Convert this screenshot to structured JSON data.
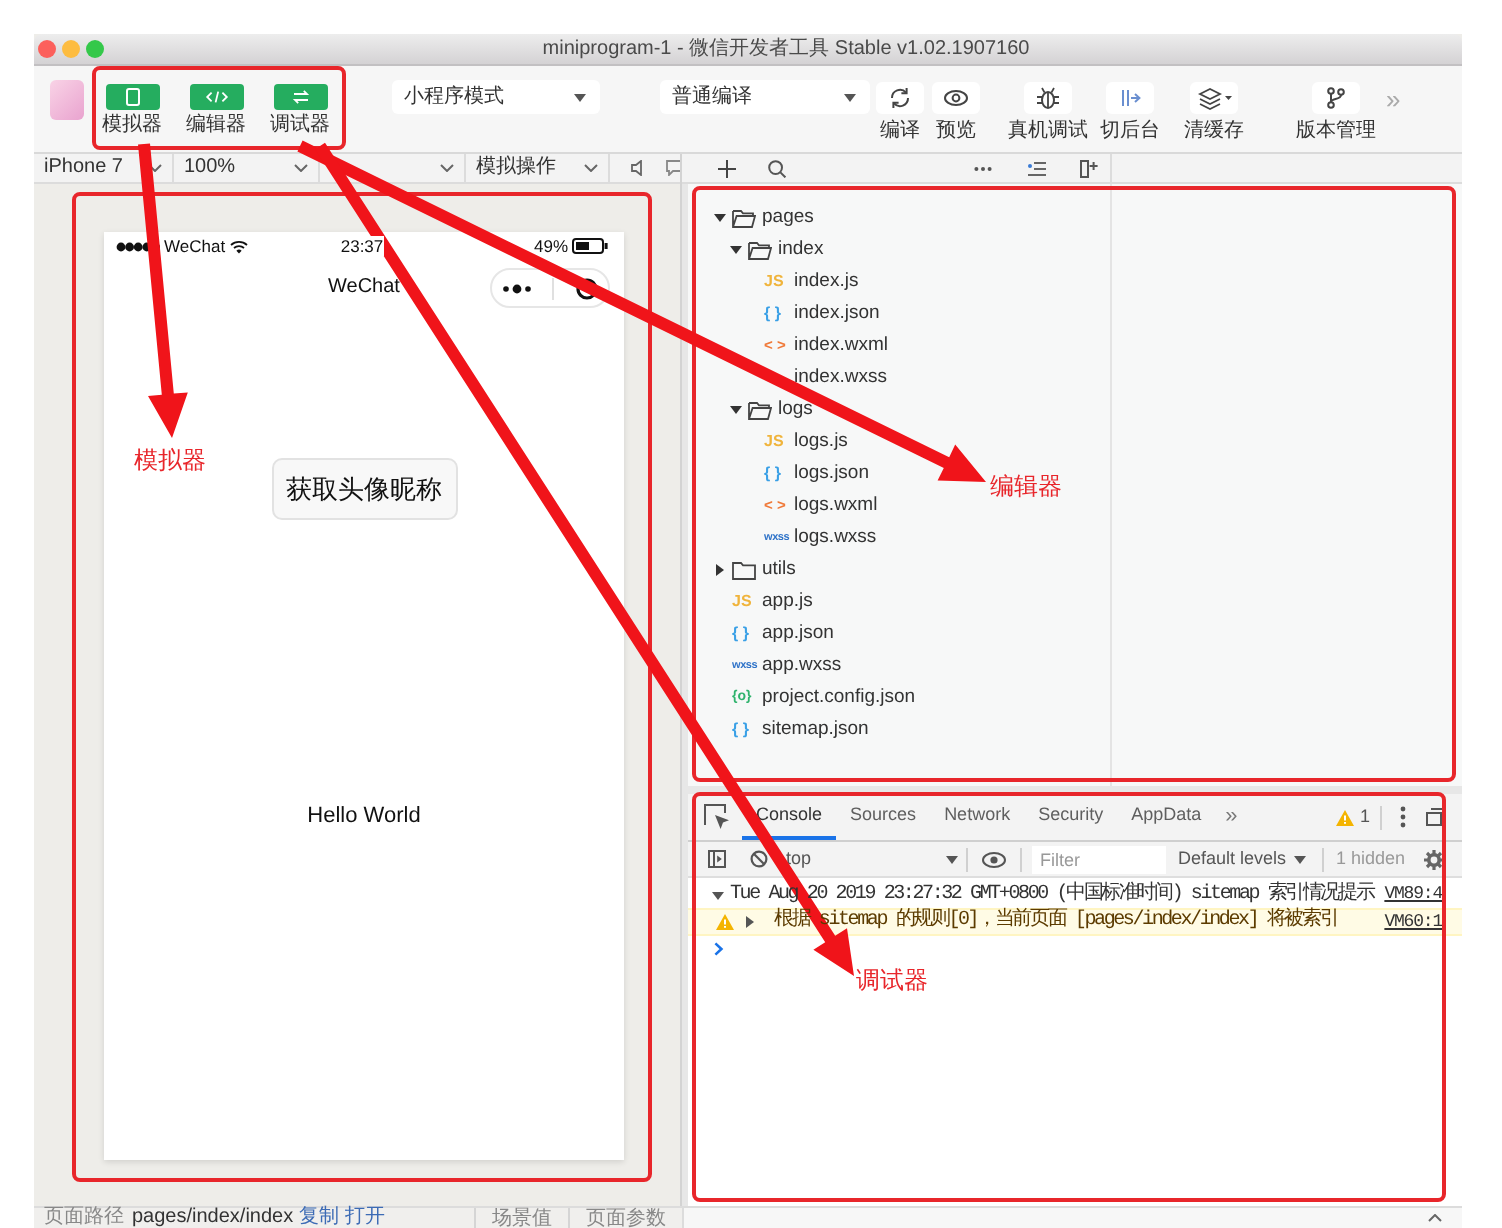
{
  "window": {
    "title": "miniprogram-1 - 微信开发者工具 Stable v1.02.1907160"
  },
  "toolbar": {
    "view_buttons": [
      {
        "kind": "simulator",
        "label": "模拟器",
        "on": true
      },
      {
        "kind": "editor",
        "label": "编辑器",
        "on": true
      },
      {
        "kind": "debugger",
        "label": "调试器",
        "on": true
      }
    ],
    "mode_select": "小程序模式",
    "compile_select": "普通编译",
    "actions": [
      {
        "kind": "compile",
        "label": "编译"
      },
      {
        "kind": "preview",
        "label": "预览"
      },
      {
        "kind": "remote_debug",
        "label": "真机调试"
      },
      {
        "kind": "background",
        "label": "切后台"
      },
      {
        "kind": "clear_cache",
        "label": "清缓存"
      },
      {
        "kind": "version",
        "label": "版本管理"
      }
    ],
    "more": "»"
  },
  "simulator_bar": {
    "device": "iPhone 7",
    "zoom": "100%",
    "operations": "模拟操作"
  },
  "phone": {
    "carrier": "WeChat",
    "time": "23:37",
    "battery": "49%",
    "nav_title": "WeChat",
    "button": "获取头像昵称",
    "content": "Hello World"
  },
  "file_tree": [
    {
      "name": "pages",
      "kind": "folder",
      "expanded": true,
      "children": [
        {
          "name": "index",
          "kind": "folder",
          "expanded": true,
          "children": [
            {
              "name": "index.js",
              "kind": "js",
              "icon": "JS"
            },
            {
              "name": "index.json",
              "kind": "json",
              "icon": "{ }"
            },
            {
              "name": "index.wxml",
              "kind": "wxml",
              "icon": "< >"
            },
            {
              "name": "index.wxss",
              "kind": "wxss"
            }
          ]
        },
        {
          "name": "logs",
          "kind": "folder",
          "expanded": true,
          "children": [
            {
              "name": "logs.js",
              "kind": "js",
              "icon": "JS"
            },
            {
              "name": "logs.json",
              "kind": "json",
              "icon": "{ }"
            },
            {
              "name": "logs.wxml",
              "kind": "wxml",
              "icon": "< >"
            },
            {
              "name": "logs.wxss",
              "kind": "wxss",
              "icon": "wxss"
            }
          ]
        }
      ]
    },
    {
      "name": "utils",
      "kind": "folder",
      "expanded": false
    },
    {
      "name": "app.js",
      "kind": "js",
      "icon": "JS"
    },
    {
      "name": "app.json",
      "kind": "json",
      "icon": "{ }"
    },
    {
      "name": "app.wxss",
      "kind": "wxss",
      "icon": "wxss"
    },
    {
      "name": "project.config.json",
      "kind": "config",
      "icon": "{o}"
    },
    {
      "name": "sitemap.json",
      "kind": "json",
      "icon": "{ }"
    }
  ],
  "debugger": {
    "tabs": [
      {
        "label": "Console",
        "selected": true
      },
      {
        "label": "Sources",
        "selected": false
      },
      {
        "label": "Network",
        "selected": false
      },
      {
        "label": "Security",
        "selected": false
      },
      {
        "label": "AppData",
        "selected": false
      }
    ],
    "more": "»",
    "warning_count": "1",
    "context": "top",
    "filter": {
      "placeholder": "Filter"
    },
    "levels": "Default levels",
    "hidden": "1 hidden",
    "messages": [
      {
        "kind": "info",
        "expanded": true,
        "text": "Tue Aug 20 2019 23:27:32 GMT+0800 (中国标准时间) sitemap 索引情况提示",
        "source": "VM89:4"
      },
      {
        "kind": "warning",
        "expanded": false,
        "text": "根据 sitemap 的规则[0]，当前页面 [pages/index/index] 将被索引",
        "source": "VM60:1"
      }
    ]
  },
  "status_bar": {
    "path_label": "页面路径",
    "path": "pages/index/index",
    "links": [
      "复制",
      "打开"
    ],
    "scene": "场景值",
    "params": "页面参数"
  },
  "annotations": [
    {
      "label": "模拟器"
    },
    {
      "label": "编辑器"
    },
    {
      "label": "调试器"
    }
  ]
}
